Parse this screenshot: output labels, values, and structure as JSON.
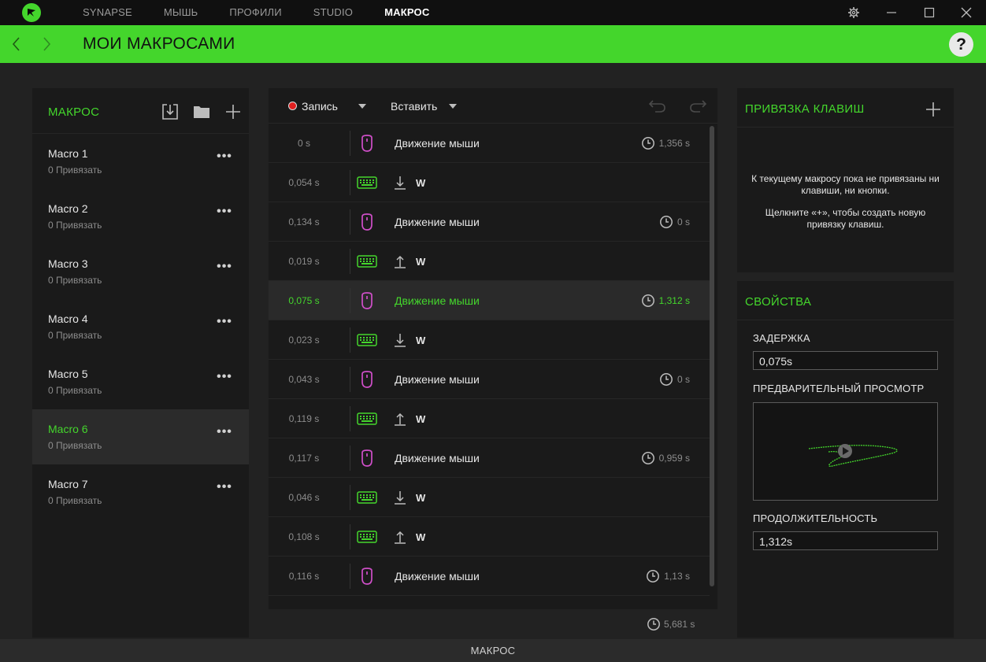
{
  "titlebar": {
    "tabs": [
      {
        "label": "SYNAPSE"
      },
      {
        "label": "МЫШЬ"
      },
      {
        "label": "ПРОФИЛИ"
      },
      {
        "label": "STUDIO"
      },
      {
        "label": "МАКРОС"
      }
    ],
    "active_tab": "МАКРОС"
  },
  "header": {
    "title": "МОИ МАКРОСАМИ",
    "help": "?"
  },
  "macro_list": {
    "title": "МАКРОС",
    "items": [
      {
        "name": "Macro 1",
        "sub": "0 Привязать"
      },
      {
        "name": "Macro 2",
        "sub": "0 Привязать"
      },
      {
        "name": "Macro 3",
        "sub": "0 Привязать"
      },
      {
        "name": "Macro 4",
        "sub": "0 Привязать"
      },
      {
        "name": "Macro 5",
        "sub": "0 Привязать"
      },
      {
        "name": "Macro 6",
        "sub": "0 Привязать"
      },
      {
        "name": "Macro 7",
        "sub": "0 Привязать"
      }
    ],
    "active_index": 5
  },
  "editor": {
    "record_label": "Запись",
    "insert_label": "Вставить",
    "rows": [
      {
        "time": "0 s",
        "type": "mouse",
        "label": "Движение мыши",
        "duration": "1,356 s"
      },
      {
        "time": "0,054 s",
        "type": "key",
        "direction": "down",
        "label": "W"
      },
      {
        "time": "0,134 s",
        "type": "mouse",
        "label": "Движение мыши",
        "duration": "0 s"
      },
      {
        "time": "0,019 s",
        "type": "key",
        "direction": "up",
        "label": "W"
      },
      {
        "time": "0,075 s",
        "type": "mouse",
        "label": "Движение мыши",
        "duration": "1,312 s",
        "active": true
      },
      {
        "time": "0,023 s",
        "type": "key",
        "direction": "down",
        "label": "W"
      },
      {
        "time": "0,043 s",
        "type": "mouse",
        "label": "Движение мыши",
        "duration": "0 s"
      },
      {
        "time": "0,119 s",
        "type": "key",
        "direction": "up",
        "label": "W"
      },
      {
        "time": "0,117 s",
        "type": "mouse",
        "label": "Движение мыши",
        "duration": "0,959 s"
      },
      {
        "time": "0,046 s",
        "type": "key",
        "direction": "down",
        "label": "W"
      },
      {
        "time": "0,108 s",
        "type": "key",
        "direction": "up",
        "label": "W"
      },
      {
        "time": "0,116 s",
        "type": "mouse",
        "label": "Движение мыши",
        "duration": "1,13 s"
      }
    ],
    "total_duration": "5,681 s"
  },
  "bindings": {
    "title": "ПРИВЯЗКА КЛАВИШ",
    "message_1": "К текущему макросу пока не привязаны ни клавиши, ни кнопки.",
    "message_2": "Щелкните «+», чтобы создать новую привязку клавиш."
  },
  "properties": {
    "title": "СВОЙСТВА",
    "delay_label": "ЗАДЕРЖКА",
    "delay_value": "0,075s",
    "preview_label": "ПРЕДВАРИТЕЛЬНЫЙ ПРОСМОТР",
    "duration_label": "ПРОДОЛЖИТЕЛЬНОСТЬ",
    "duration_value": "1,312s"
  },
  "statusbar": {
    "label": "МАКРОС"
  },
  "colors": {
    "accent": "#44d62c",
    "mouse_icon": "#d04fc9",
    "keyboard_icon": "#44d62c",
    "record": "#e02020",
    "partial_icon": "#ff9a1f"
  }
}
